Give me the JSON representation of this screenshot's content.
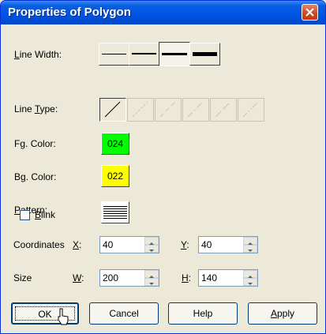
{
  "window": {
    "title": "Properties of Polygon"
  },
  "line_width": {
    "label_ul": "L",
    "label_rest": "ine Width:",
    "selected_index": 2
  },
  "line_type": {
    "label_pre": "Line ",
    "label_ul": "T",
    "label_rest": "ype:",
    "selected_index": 0
  },
  "fg_color": {
    "label_pre": "F",
    "label_ul": "g",
    "label_rest": ". Color:",
    "value": "024",
    "color": "#00ff00"
  },
  "bg_color": {
    "label_pre": "B",
    "label_ul": "g",
    "label_rest": ". Color:",
    "value": "022",
    "color": "#ffff00"
  },
  "pattern": {
    "label_ul": "P",
    "label_rest": "attern:"
  },
  "blink": {
    "label_ul": "B",
    "label_rest": "link",
    "checked": false
  },
  "coordinates": {
    "label": "Coordinates",
    "x_ul": "X",
    "x_rest": ":",
    "x_value": "40",
    "y_ul": "Y",
    "y_rest": ":",
    "y_value": "40"
  },
  "size": {
    "label": "Size",
    "w_ul": "W",
    "w_rest": ":",
    "w_value": "200",
    "h_ul": "H",
    "h_rest": ":",
    "h_value": "140"
  },
  "buttons": {
    "ok": "OK",
    "cancel": "Cancel",
    "help": "Help",
    "apply_ul": "A",
    "apply_rest": "pply"
  }
}
